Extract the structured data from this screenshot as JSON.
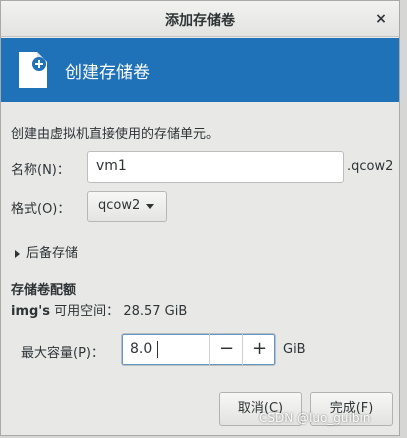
{
  "window": {
    "title": "添加存储卷",
    "close_glyph": "×"
  },
  "banner": {
    "title": "创建存储卷",
    "icon": "new-file-icon",
    "color": "#1f71b8"
  },
  "description": "创建由虚拟机直接使用的存储单元。",
  "name": {
    "label": "名称(N)：",
    "value": "vm1",
    "suffix": ".qcow2"
  },
  "format": {
    "label": "格式(O)：",
    "value": "qcow2"
  },
  "backing": {
    "label": "后备存储"
  },
  "quota": {
    "title": "存储卷配额",
    "pool_name": "img's",
    "available_label": "可用空间：",
    "available_value": "28.57 GiB",
    "max_label": "最大容量(P)：",
    "max_value": "8.0",
    "unit": "GiB",
    "minus_glyph": "−",
    "plus_glyph": "+"
  },
  "buttons": {
    "cancel": "取消(C)",
    "finish": "完成(F)"
  },
  "watermark": "CSDN @luo_guibin"
}
